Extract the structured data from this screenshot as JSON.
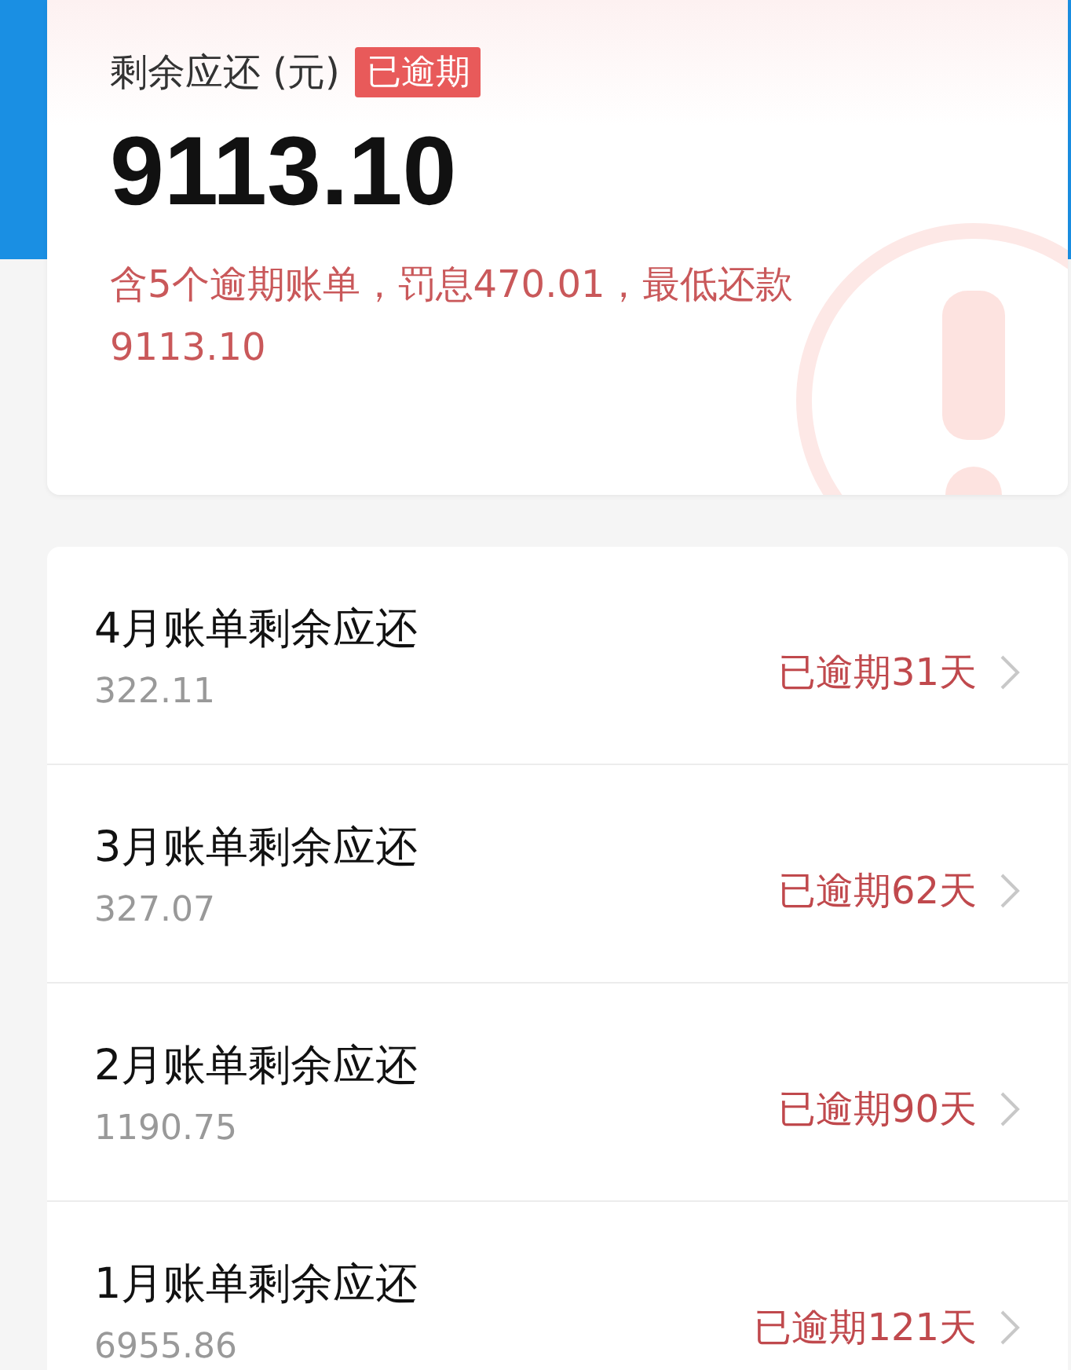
{
  "summary": {
    "label": "剩余应还 (元)",
    "badge": "已逾期",
    "amount": "9113.10",
    "note": "含5个逾期账单，罚息470.01，最低还款9113.10"
  },
  "bills": [
    {
      "title": "4月账单剩余应还",
      "amount": "322.11",
      "status": "已逾期31天"
    },
    {
      "title": "3月账单剩余应还",
      "amount": "327.07",
      "status": "已逾期62天"
    },
    {
      "title": "2月账单剩余应还",
      "amount": "1190.75",
      "status": "已逾期90天"
    },
    {
      "title": "1月账单剩余应还",
      "amount": "6955.86",
      "status": "已逾期121天"
    }
  ]
}
